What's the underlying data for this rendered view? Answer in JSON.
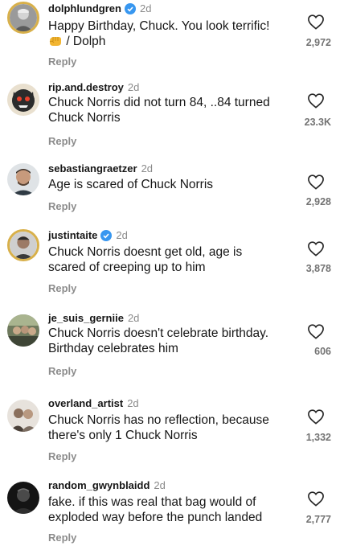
{
  "comments": [
    {
      "user": "dolphlundgren",
      "verified": true,
      "time": "2d",
      "line1": "Happy Birthday, Chuck. You look terrific!",
      "emoji": "fist-emoji",
      "line2": "/ Dolph",
      "reply": "Reply",
      "likes": "2,972"
    },
    {
      "user": "rip.and.destroy",
      "verified": false,
      "time": "2d",
      "line1": "Chuck Norris did not turn 84, ..84 turned",
      "line2": "Chuck Norris",
      "reply": "Reply",
      "likes": "23.3K"
    },
    {
      "user": "sebastiangraetzer",
      "verified": false,
      "time": "2d",
      "line1": "Age is scared of Chuck Norris",
      "line2": "",
      "reply": "Reply",
      "likes": "2,928"
    },
    {
      "user": "justintaite",
      "verified": true,
      "time": "2d",
      "line1": "Chuck Norris doesnt get old, age is",
      "line2": "scared of creeping up to him",
      "reply": "Reply",
      "likes": "3,878"
    },
    {
      "user": "je_suis_gerniie",
      "verified": false,
      "time": "2d",
      "line1": "Chuck Norris doesn't celebrate birthday.",
      "line2": "Birthday celebrates him",
      "reply": "Reply",
      "likes": "606"
    },
    {
      "user": "overland_artist",
      "verified": false,
      "time": "2d",
      "line1": "Chuck Norris has no reflection, because",
      "line2": "there's only 1 Chuck Norris",
      "reply": "Reply",
      "likes": "1,332"
    },
    {
      "user": "random_gwynblaidd",
      "verified": false,
      "time": "2d",
      "line1": "fake. if this was real that bag would of",
      "line2": "exploded way before the punch landed",
      "reply": "Reply",
      "likes": "2,777"
    }
  ],
  "colors": {
    "verified": "#3897f0",
    "story_ring": "#d8b04a",
    "meta_gray": "#8a8a8a"
  },
  "icons": {
    "like": "heart-outline-icon",
    "verified": "verified-badge-icon"
  }
}
